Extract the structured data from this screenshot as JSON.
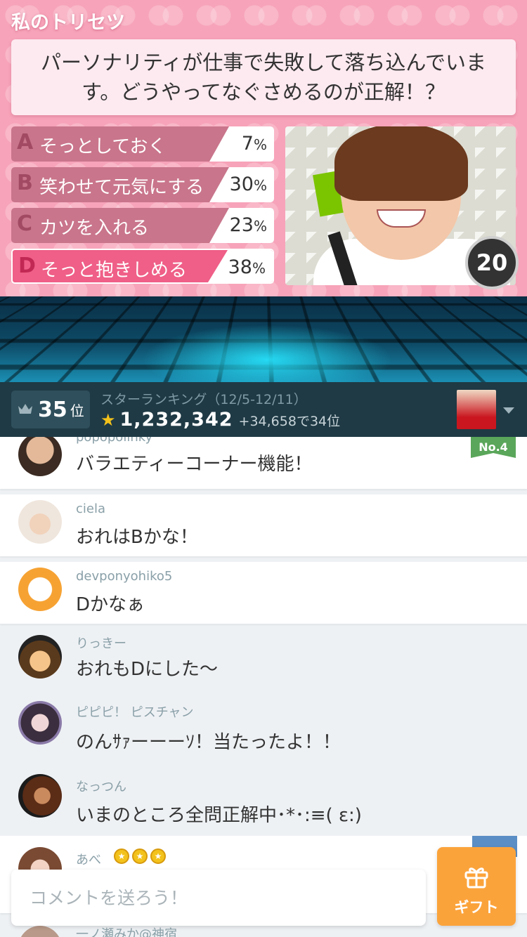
{
  "quiz": {
    "title": "私のトリセツ",
    "question": "パーソナリティが仕事で失敗して落ち込んでいます。どうやってなぐさめるのが正解！？",
    "answers": [
      {
        "letter": "A",
        "text": "そっとしておく",
        "percent": "7",
        "unit": "%"
      },
      {
        "letter": "B",
        "text": "笑わせて元気にする",
        "percent": "30",
        "unit": "%"
      },
      {
        "letter": "C",
        "text": "カツを入れる",
        "percent": "23",
        "unit": "%"
      },
      {
        "letter": "D",
        "text": "そっと抱きしめる",
        "percent": "38",
        "unit": "%"
      }
    ],
    "timer": "20"
  },
  "ranking": {
    "rank": "35",
    "rank_suffix": "位",
    "label": "スターランキング（12/5-12/11）",
    "score": "1,232,342",
    "delta": "+34,658で34位"
  },
  "comments": [
    {
      "user": "popopolinky",
      "message": "バラエティーコーナー機能！",
      "badge": "No.4"
    },
    {
      "user": "ciela",
      "message": "おれはBかな！"
    },
    {
      "user": "devponyohiko5",
      "message": "Dかなぁ"
    },
    {
      "user": "りっきー",
      "message": "おれもDにした〜"
    },
    {
      "user": "ピピピ！ ピスチャン",
      "message": "のんｻｧーーーｿ！当たったよ！！"
    },
    {
      "user": "なっつん",
      "message": "いまのところ全問正解中･*･:≡( ε:)"
    },
    {
      "user": "あべ",
      "message": ""
    },
    {
      "user": "一ノ瀬みか@神宿",
      "message": ""
    }
  ],
  "composer": {
    "placeholder": "コメントを送ろう！",
    "gift_label": "ギフト"
  }
}
